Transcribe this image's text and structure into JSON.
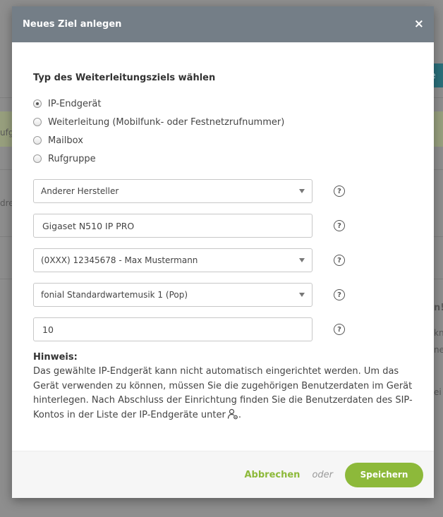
{
  "background": {
    "tab_fragment": "fe",
    "frag_left1": "ufg",
    "frag_left2": "dres",
    "frag_right1": "n!",
    "frag_right2": "kn",
    "frag_right3": "ne",
    "frag_right4": "ei"
  },
  "modal": {
    "title": "Neues Ziel anlegen",
    "close_icon": "×"
  },
  "target_type": {
    "title": "Typ des Weiterleitungsziels wählen",
    "options": [
      {
        "label": "IP-Endgerät",
        "checked": true
      },
      {
        "label": "Weiterleitung (Mobilfunk- oder Festnetzrufnummer)",
        "checked": false
      },
      {
        "label": "Mailbox",
        "checked": false
      },
      {
        "label": "Rufgruppe",
        "checked": false
      }
    ]
  },
  "fields": {
    "manufacturer": "Anderer Hersteller",
    "device_name": "Gigaset N510 IP PRO",
    "phone_number": "(0XXX) 12345678 - Max Mustermann",
    "hold_music": "fonial Standardwartemusik 1 (Pop)",
    "number_value": "10",
    "help_glyph": "?"
  },
  "hint": {
    "title": "Hinweis:",
    "text": "Das gewählte IP-Endgerät kann nicht automatisch eingerichtet werden. Um das Gerät verwenden zu können, müssen Sie die zugehörigen Benutzerdaten im Gerät hinterlegen. Nach Abschluss der Einrichtung finden Sie die Benutzerdaten des SIP-Kontos in der Liste der IP-Endgeräte unter",
    "suffix": ".",
    "icon": "user-settings-icon"
  },
  "footer": {
    "cancel_label": "Abbrechen",
    "or_label": "oder",
    "save_label": "Speichern"
  },
  "colors": {
    "header_bg": "#747e87",
    "accent_green": "#8db93a",
    "overlay": "#8e8e8e"
  }
}
